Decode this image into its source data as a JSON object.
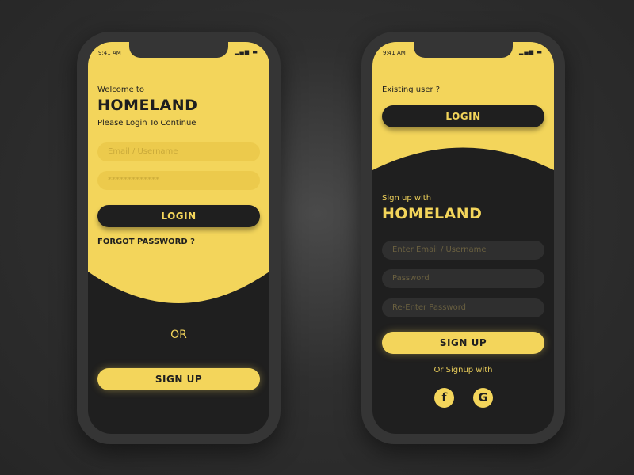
{
  "colors": {
    "accent": "#f3d55b",
    "dark": "#1f1f1f",
    "frame": "#353535"
  },
  "status_bar": {
    "time": "9:41 AM",
    "icons": "signal-icon battery-icon"
  },
  "login_screen": {
    "welcome": "Welcome to",
    "brand": "HOMELAND",
    "subtitle": "Please Login To Continue",
    "email_placeholder": "Email / Username",
    "password_value": "*************",
    "login_label": "LOGIN",
    "forgot_label": "FORGOT PASSWORD ?",
    "or_label": "OR",
    "signup_label": "SIGN UP"
  },
  "signup_screen": {
    "existing_user": "Existing user ?",
    "login_label": "LOGIN",
    "signup_with": "Sign up with",
    "brand": "HOMELAND",
    "email_placeholder": "Enter Email / Username",
    "password_placeholder": "Password",
    "reenter_placeholder": "Re-Enter Password",
    "signup_label": "SIGN UP",
    "or_signup_with": "Or Signup with",
    "facebook_glyph": "f",
    "google_glyph": "G"
  }
}
